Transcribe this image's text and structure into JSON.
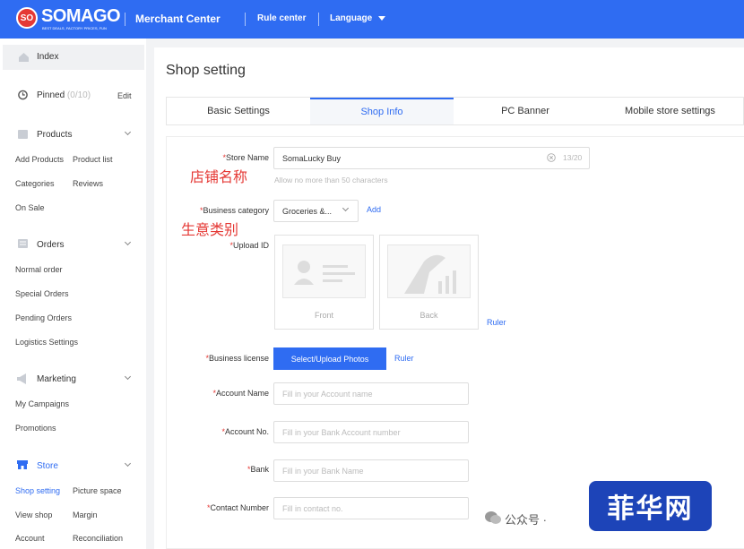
{
  "header": {
    "logo": "SO",
    "brand": "SOMAGO",
    "tagline": "BEST DEALS, FACTORY PRICES, FUN",
    "nav": [
      "Merchant Center",
      "Rule center",
      "Language"
    ]
  },
  "sidebar": {
    "index": "Index",
    "pinned": "Pinned",
    "pinned_count": "(0/10)",
    "edit": "Edit",
    "products": "Products",
    "add_products": "Add Products",
    "product_list": "Product list",
    "categories": "Categories",
    "reviews": "Reviews",
    "on_sale": "On Sale",
    "orders": "Orders",
    "normal_order": "Normal order",
    "special_orders": "Special Orders",
    "pending_orders": "Pending Orders",
    "logistics_settings": "Logistics Settings",
    "marketing": "Marketing",
    "my_campaigns": "My Campaigns",
    "promotions": "Promotions",
    "store": "Store",
    "shop_setting": "Shop setting",
    "picture_space": "Picture space",
    "view_shop": "View shop",
    "margin": "Margin",
    "account": "Account",
    "reconciliation": "Reconciliation"
  },
  "page": {
    "title": "Shop setting",
    "tabs": [
      "Basic Settings",
      "Shop Info",
      "PC Banner",
      "Mobile store settings"
    ],
    "active_tab": 1
  },
  "form": {
    "req": "*",
    "store_name_label": "Store Name",
    "store_name_value": "SomaLucky Buy",
    "store_name_count": "13/20",
    "store_name_hint": "Allow no more than 50 characters",
    "business_category_label": "Business category",
    "business_category_value": "Groceries &...",
    "business_category_add": "Add",
    "upload_id_label": "Upload ID",
    "front": "Front",
    "back": "Back",
    "ruler": "Ruler",
    "business_license_label": "Business license",
    "select_upload": "Select/Upload Photos",
    "account_name_label": "Account Name",
    "account_name_ph": "Fill in your Account name",
    "account_no_label": "Account No.",
    "account_no_ph": "Fill in your Bank Account number",
    "bank_label": "Bank",
    "bank_ph": "Fill in your Bank Name",
    "contact_label": "Contact Number",
    "contact_ph": "Fill in contact no."
  },
  "annotations": {
    "store_name_cn": "店铺名称",
    "business_category_cn": "生意类别"
  },
  "watermark": {
    "wechat": "公众号 ·",
    "badge": "菲华网"
  },
  "colors": {
    "brand": "#2f6cf2",
    "annotation": "#e53935"
  }
}
